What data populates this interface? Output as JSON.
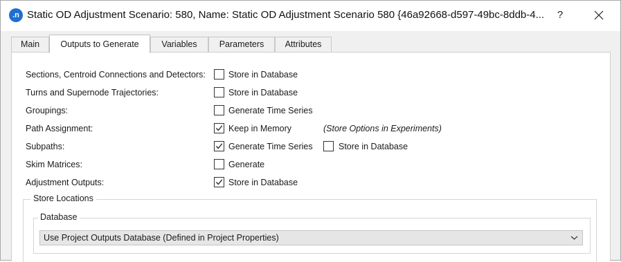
{
  "window": {
    "app_icon_text": ".n",
    "title": "Static OD Adjustment Scenario: 580, Name: Static OD Adjustment Scenario 580  {46a92668-d597-49bc-8ddb-4...",
    "help_label": "?"
  },
  "tabs": [
    {
      "label": "Main",
      "active": false
    },
    {
      "label": "Outputs to Generate",
      "active": true
    },
    {
      "label": "Variables",
      "active": false
    },
    {
      "label": "Parameters",
      "active": false
    },
    {
      "label": "Attributes",
      "active": false
    }
  ],
  "outputs": {
    "rows": [
      {
        "label": "Sections, Centroid Connections and Detectors:",
        "option": "Store in Database",
        "checked": false
      },
      {
        "label": "Turns and Supernode Trajectories:",
        "option": "Store in Database",
        "checked": false
      },
      {
        "label": "Groupings:",
        "option": "Generate Time Series",
        "checked": false
      },
      {
        "label": "Path Assignment:",
        "option": "Keep in Memory",
        "checked": true,
        "note": "(Store Options in Experiments)"
      },
      {
        "label": "Subpaths:",
        "option": "Generate Time Series",
        "checked": true,
        "option2": "Store in Database",
        "checked2": false
      },
      {
        "label": "Skim Matrices:",
        "option": "Generate",
        "checked": false
      },
      {
        "label": "Adjustment Outputs:",
        "option": "Store in Database",
        "checked": true
      }
    ]
  },
  "store_locations": {
    "title": "Store Locations",
    "database": {
      "title": "Database",
      "selected": "Use Project Outputs Database (Defined in Project Properties)"
    }
  }
}
